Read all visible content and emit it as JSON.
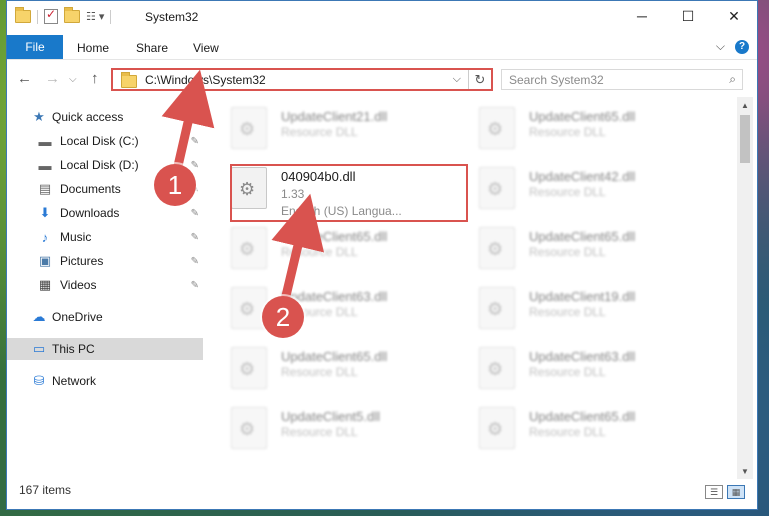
{
  "window": {
    "title": "System32",
    "controls": {
      "minimize": "─",
      "maximize": "☐",
      "close": "✕"
    }
  },
  "ribbon": {
    "tabs": [
      "File",
      "Home",
      "Share",
      "View"
    ],
    "expand": "⌵",
    "help": "?"
  },
  "address": {
    "back": "←",
    "forward": "→",
    "up": "↑",
    "path": "C:\\Windows\\System32",
    "dropdown": "⌵",
    "refresh": "↻"
  },
  "search": {
    "placeholder": "Search System32",
    "icon": "⌕"
  },
  "navpane": {
    "items": [
      {
        "label": "Quick access",
        "icon": "star-icon",
        "glyph": "★",
        "pinned": false
      },
      {
        "label": "Local Disk (C:)",
        "icon": "drive-icon",
        "glyph": "▬",
        "pinned": true
      },
      {
        "label": "Local Disk (D:)",
        "icon": "drive-icon",
        "glyph": "▬",
        "pinned": true
      },
      {
        "label": "Documents",
        "icon": "documents-icon",
        "glyph": "▤",
        "pinned": true
      },
      {
        "label": "Downloads",
        "icon": "downloads-icon",
        "glyph": "⬇",
        "pinned": true
      },
      {
        "label": "Music",
        "icon": "music-icon",
        "glyph": "♪",
        "pinned": true
      },
      {
        "label": "Pictures",
        "icon": "pictures-icon",
        "glyph": "▣",
        "pinned": true
      },
      {
        "label": "Videos",
        "icon": "videos-icon",
        "glyph": "▦",
        "pinned": true
      },
      {
        "label": "OneDrive",
        "icon": "cloud-icon",
        "glyph": "☁",
        "pinned": false
      },
      {
        "label": "This PC",
        "icon": "computer-icon",
        "glyph": "▭",
        "pinned": false
      },
      {
        "label": "Network",
        "icon": "network-icon",
        "glyph": "⛁",
        "pinned": false
      }
    ],
    "pin_glyph": "📌"
  },
  "files": {
    "left": [
      {
        "name": "UpdateClient21.dll",
        "type": "Resource DLL"
      },
      {
        "name": "040904b0.dll",
        "version": "1.33",
        "desc": "English (US) Langua..."
      },
      {
        "name": "UpdateClient65.dll",
        "type": "Resource DLL"
      },
      {
        "name": "UpdateClient63.dll",
        "type": "Resource DLL"
      },
      {
        "name": "UpdateClient65.dll",
        "type": "Resource DLL"
      },
      {
        "name": "UpdateClient5.dll",
        "type": "Resource DLL"
      }
    ],
    "right": [
      {
        "name": "UpdateClient65.dll",
        "type": "Resource DLL"
      },
      {
        "name": "UpdateClient42.dll",
        "type": "Resource DLL"
      },
      {
        "name": "UpdateClient65.dll",
        "type": "Resource DLL"
      },
      {
        "name": "UpdateClient19.dll",
        "type": "Resource DLL"
      },
      {
        "name": "UpdateClient63.dll",
        "type": "Resource DLL"
      },
      {
        "name": "UpdateClient65.dll",
        "type": "Resource DLL"
      }
    ]
  },
  "status": {
    "count": "167 items"
  },
  "annotations": {
    "step1": "1",
    "step2": "2",
    "color": "#d9534f"
  }
}
